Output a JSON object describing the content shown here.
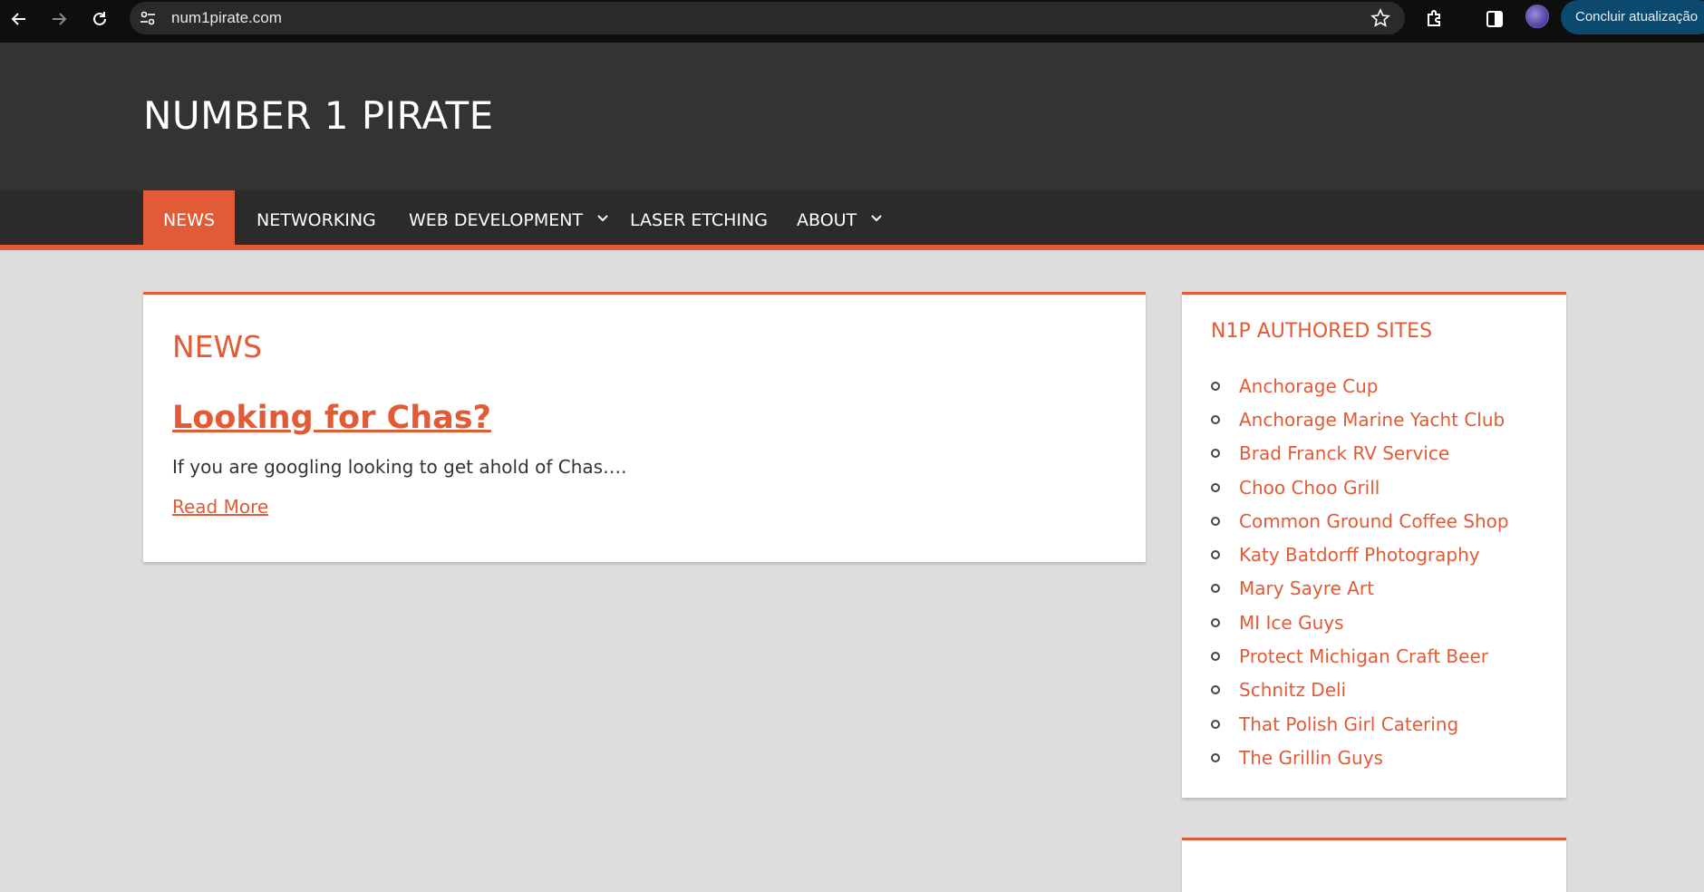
{
  "browser": {
    "url": "num1pirate.com",
    "update_button": "Concluir atualização"
  },
  "site": {
    "title": "NUMBER 1 PIRATE"
  },
  "nav": {
    "items": [
      {
        "label": "NEWS",
        "active": true
      },
      {
        "label": "NETWORKING"
      },
      {
        "label": "WEB DEVELOPMENT",
        "dropdown": true
      },
      {
        "label": "LASER ETCHING"
      },
      {
        "label": "ABOUT",
        "dropdown": true
      }
    ]
  },
  "main": {
    "heading": "NEWS",
    "post": {
      "title": "Looking for Chas?",
      "excerpt": "If you are googling looking to get ahold of Chas….",
      "read_more": "Read More"
    }
  },
  "sidebar": {
    "title": "N1P AUTHORED SITES",
    "sites": [
      "Anchorage Cup",
      "Anchorage Marine Yacht Club",
      "Brad Franck RV Service",
      "Choo Choo Grill",
      "Common Ground Coffee Shop",
      "Katy Batdorff Photography",
      "Mary Sayre Art",
      "MI Ice Guys",
      "Protect Michigan Craft Beer",
      "Schnitz Deli",
      "That Polish Girl Catering",
      "The Grillin Guys"
    ]
  },
  "colors": {
    "accent": "#e15b37",
    "header_bg": "#333333",
    "nav_bg": "#2b2b2b",
    "page_bg": "#dddddd"
  }
}
